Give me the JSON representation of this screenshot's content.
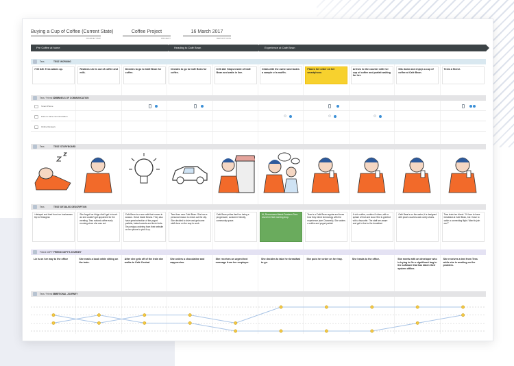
{
  "header": {
    "title": "Buying a Cup of Coffee (Current State)",
    "title_label": "JOURNEY MAP",
    "project": "Coffee Project",
    "project_label": "PROJECT",
    "date": "16 March 2017",
    "date_label": "REPORT DATE"
  },
  "phases": [
    "Pre Coffee at home",
    "Heading to Café Bean",
    "Experience at Café Bean"
  ],
  "sections": {
    "working": {
      "who": "Tess",
      "title": "TESS' WORKING"
    },
    "channels": {
      "who": "Tess / Friend CDPY",
      "title": "CHANNELS OF COMMUNICATION"
    },
    "storyboard": {
      "who": "Tess",
      "title": "TESS' STORYBOARD"
    },
    "description": {
      "who": "Tess",
      "title": "TESS' DETAILED DESCRIPTION"
    },
    "friend": {
      "who": "Friend CDPY",
      "title": "FRIEND CDPY'S JOURNEY"
    },
    "emotion": {
      "who": "Tess / Friend CDPY",
      "title": "EMOTIONAL JOURNEY"
    }
  },
  "working_steps": [
    "7:00 AM. Tess wakes up.",
    "Realizes she is out of coffee and milk.",
    "Decides to go to Café Bean for coffee.",
    "Decides to go to Café Bean for coffee.",
    "8:00 AM. Stops inside of Café Bean and waits in line.",
    "Chats with the owner and tastes a sample of a muffin.",
    "Places her order on her smartphone.",
    "Arrives to the counter with her cup of coffee and parfait waiting for her.",
    "Sits down and enjoys a cup of coffee at Café Bean.",
    "Texts a friend."
  ],
  "channels": [
    "Smart Phone",
    "Face to Face communication",
    "Online Reviews"
  ],
  "storyboard_icons": [
    "sleeping-person-icon",
    "tired-person-icon",
    "light-bulb-icon",
    "car-icon",
    "person-at-shop-icon",
    "person-chatting-icon",
    "person-on-phone-icon",
    "person-with-coffee-icon",
    "person-drinking-icon",
    "person-texting-icon"
  ],
  "descriptions": [
    "+delayed and tired from her businesses trip to Shanghai.",
    "She forgot her fridge didn't get in touch as she couldn't get appointed for the meeting. Tess noticed coffee early morning since she was out.",
    "Café Bean is a new café that comes in season. Great Inside Beans. They also have great selection of the yogurt parfaits, baked sweets and fresh fruits. Tess enjoys ordering from their website on her phone to pick it up.",
    "Tess lives near Café Bean. She has a personal reason to check out the city. She decided to drive and get some stuff done on the way to work.",
    "Café Bean prides itself on being a progressive, customer friendly, community space.",
    "Hi, Recommend latest Features Tess loved her first morning drop.",
    "Tess is a Café Bean regular and loves how they blend technology with the experience (see Channels). She orders a coffee and yogurt parfait.",
    "A chic coffee, cookies & vibes, with a splash of fruit and local. She is greeted with a favourite. The staff are aware and get in line to the breakfast.",
    "Café Bean's on the water, it is designed with plush couches and comfy chairs.",
    "Tess texts her friend: \"I'd love to have breakfast at Café Bean, but I have to catch a connecting flight. Want to join me?\""
  ],
  "friend_steps": [
    "Liz is on her way to the office",
    "She reads a book while sitting on the train.",
    "After she gets off of the train she walks to Café Central.",
    "She orders a chocolatine and cappuccino.",
    "She receives an urgent text message from her employer.",
    "She decides to take her breakfast to go.",
    "She puts her order on her tray.",
    "She heads to the office.",
    "She meets with an developer who is trying to fix a significant bug in the software that has taken their system offline.",
    "She receives a text from Tess while she is working on the problem."
  ],
  "chart_data": {
    "type": "line",
    "x": [
      1,
      2,
      3,
      4,
      5,
      6,
      7,
      8,
      9,
      10
    ],
    "ylim": [
      1,
      4
    ],
    "series": [
      {
        "values": [
          3,
          2,
          3,
          3,
          2,
          4,
          4,
          4,
          4,
          4
        ],
        "color": "#a9c4e6"
      },
      {
        "values": [
          2,
          3,
          2,
          2,
          1,
          1,
          1,
          1,
          2,
          3
        ],
        "color": "#a9c4e6"
      }
    ],
    "marker_color": "#f2c744",
    "grid": true
  },
  "colors": {
    "phase": "#3c4346",
    "accent_yellow": "#f7d12e",
    "accent_green": "#6aab5d",
    "dot_blue": "#3a8fd6"
  }
}
